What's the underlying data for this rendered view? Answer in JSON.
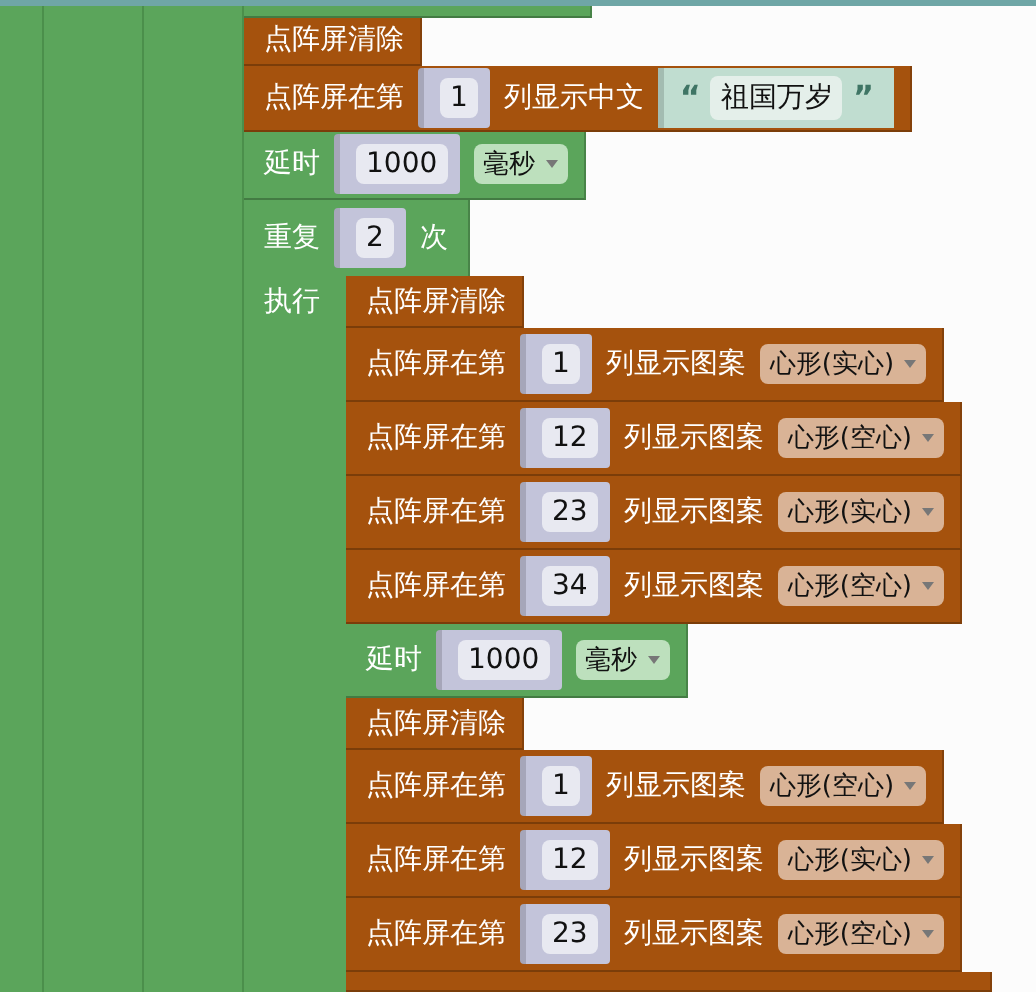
{
  "blocks": [
    {
      "kind": "cut"
    },
    {
      "kind": "clear",
      "label": "点阵屏清除"
    },
    {
      "kind": "show_text",
      "label": "点阵屏在第",
      "column": "1",
      "label2": "列显示中文",
      "open_quote": "“",
      "text": "祖国万岁",
      "close_quote": "”"
    },
    {
      "kind": "delay",
      "label": "延时",
      "value": "1000",
      "unit": "毫秒"
    },
    {
      "kind": "repeat",
      "label": "重复",
      "count": "2",
      "label2": "次",
      "do_label": "执行",
      "children": [
        {
          "kind": "clear",
          "label": "点阵屏清除"
        },
        {
          "kind": "show_pattern",
          "label": "点阵屏在第",
          "column": "1",
          "label2": "列显示图案",
          "pattern": "心形(实心)"
        },
        {
          "kind": "show_pattern",
          "label": "点阵屏在第",
          "column": "12",
          "label2": "列显示图案",
          "pattern": "心形(空心)"
        },
        {
          "kind": "show_pattern",
          "label": "点阵屏在第",
          "column": "23",
          "label2": "列显示图案",
          "pattern": "心形(实心)"
        },
        {
          "kind": "show_pattern",
          "label": "点阵屏在第",
          "column": "34",
          "label2": "列显示图案",
          "pattern": "心形(空心)"
        },
        {
          "kind": "delay",
          "label": "延时",
          "value": "1000",
          "unit": "毫秒"
        },
        {
          "kind": "clear",
          "label": "点阵屏清除"
        },
        {
          "kind": "show_pattern",
          "label": "点阵屏在第",
          "column": "1",
          "label2": "列显示图案",
          "pattern": "心形(空心)"
        },
        {
          "kind": "show_pattern",
          "label": "点阵屏在第",
          "column": "12",
          "label2": "列显示图案",
          "pattern": "心形(实心)"
        },
        {
          "kind": "show_pattern",
          "label": "点阵屏在第",
          "column": "23",
          "label2": "列显示图案",
          "pattern": "心形(空心)"
        },
        {
          "kind": "cut_brown"
        }
      ]
    }
  ]
}
